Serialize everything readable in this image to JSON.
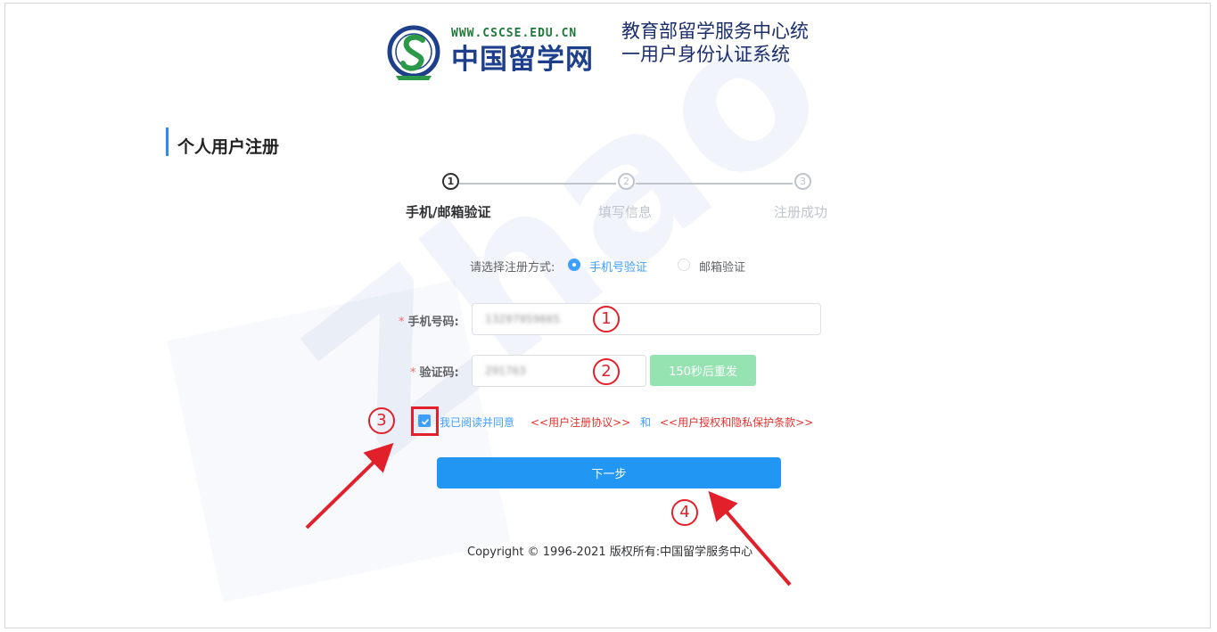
{
  "header": {
    "logo_url_text": "WWW.CSCSE.EDU.CN",
    "logo_cn_text": "中国留学网",
    "system_title": "教育部留学服务中心统一用户身份认证系统"
  },
  "page_title": "个人用户注册",
  "steps": [
    {
      "number": "1",
      "label": "手机/邮箱验证",
      "state": "current"
    },
    {
      "number": "2",
      "label": "填写信息",
      "state": "pending"
    },
    {
      "number": "3",
      "label": "注册成功",
      "state": "pending"
    }
  ],
  "method": {
    "label": "请选择注册方式:",
    "options": [
      {
        "label": "手机号验证",
        "checked": true
      },
      {
        "label": "邮箱验证",
        "checked": false
      }
    ]
  },
  "form": {
    "phone_label": "手机号码:",
    "phone_value": "13297959665",
    "code_label": "验证码:",
    "code_value": "291763",
    "required_mark": "*",
    "resend_label": "150秒后重发"
  },
  "agreement": {
    "checked": true,
    "text": "我已阅读并同意",
    "link1": "<<用户注册协议>>",
    "and": "和",
    "link2": "<<用户授权和隐私保护条款>>"
  },
  "next_button": "下一步",
  "copyright": "Copyright © 1996-2021 版权所有:中国留学服务中心",
  "watermark_text": "Zhao",
  "annotations": {
    "numbers": [
      "1",
      "2",
      "3",
      "4"
    ],
    "color": "#e2202b"
  },
  "colors": {
    "primary": "#2196f3",
    "link_red": "#e5322d",
    "resend_green": "#95e3b1",
    "title_accent": "#2b8cf5"
  }
}
